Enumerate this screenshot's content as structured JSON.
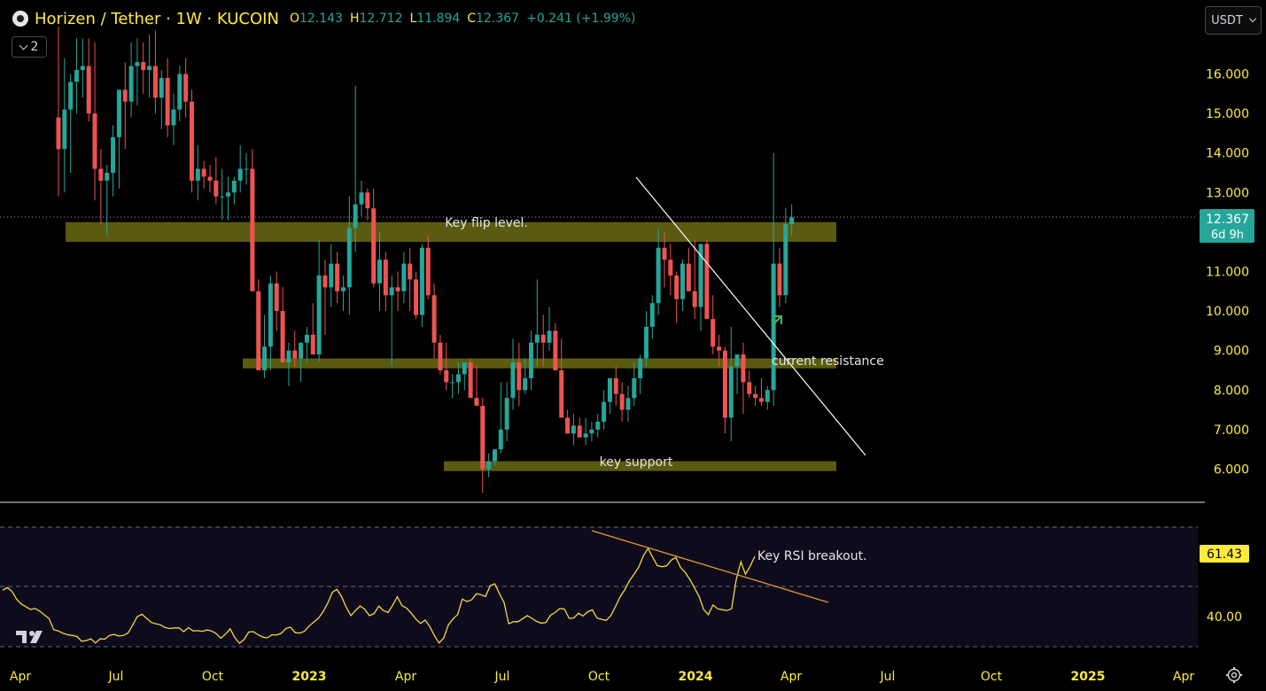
{
  "header": {
    "symbol_label": "Horizen / Tether · 1W · KUCOIN",
    "ohlc": [
      {
        "key": "O",
        "value": "12.143"
      },
      {
        "key": "H",
        "value": "12.712"
      },
      {
        "key": "L",
        "value": "11.894"
      },
      {
        "key": "C",
        "value": "12.367"
      }
    ],
    "change": "+0.241 (+1.99%)",
    "indicators_count": "2"
  },
  "currency_selector": {
    "value": "USDT"
  },
  "price_axis": {
    "ticks": [
      "16.000",
      "15.000",
      "14.000",
      "13.000",
      "11.000",
      "10.000",
      "9.000",
      "8.000",
      "7.000",
      "6.000"
    ],
    "last_price": "12.367",
    "countdown": "6d 9h"
  },
  "rsi_axis": {
    "ticks": [
      "40.00"
    ],
    "last_value": "61.43"
  },
  "time_axis": {
    "ticks": [
      "Apr",
      "Jul",
      "Oct",
      "2023",
      "Apr",
      "Jul",
      "Oct",
      "2024",
      "Apr",
      "Jul",
      "Oct",
      "2025",
      "Apr"
    ]
  },
  "annotations": {
    "flip_level": "Key flip level.",
    "current_resistance": "current resistance",
    "key_support": "key support",
    "rsi_breakout": "Key RSI breakout."
  },
  "colors": {
    "background": "#000000",
    "up": "#26a69a",
    "down": "#ef5350",
    "accent": "#ffeb3b",
    "zone": "#6b6a14",
    "rsi_line": "#f5d742",
    "trendline": "#ffffff",
    "rsi_trendline": "#e89a2c",
    "arrow": "#4caf50"
  },
  "icons": {
    "logo": "horizen-coin-icon",
    "collapse": "chevron-down-icon",
    "currency": "chevron-down-icon",
    "tradingview": "tradingview-logo",
    "settings": "gear-icon"
  },
  "chart_data": [
    {
      "type": "candlestick",
      "title": "Horizen / Tether · 1W · KUCOIN",
      "ylim": [
        5.3,
        17.0
      ],
      "zones": [
        {
          "label": "Key flip level.",
          "range": [
            11.75,
            12.25
          ]
        },
        {
          "label": "current resistance",
          "range": [
            8.55,
            8.8
          ]
        },
        {
          "label": "key support",
          "range": [
            5.95,
            6.2
          ]
        }
      ],
      "candles": [
        [
          14.9,
          17.2,
          12.9,
          14.1
        ],
        [
          14.1,
          16.4,
          13.0,
          15.1
        ],
        [
          15.1,
          16.0,
          13.5,
          15.8
        ],
        [
          15.8,
          16.9,
          15.0,
          16.1
        ],
        [
          16.1,
          16.9,
          15.4,
          16.2
        ],
        [
          16.2,
          16.9,
          14.8,
          15.0
        ],
        [
          15.0,
          16.8,
          12.8,
          13.6
        ],
        [
          13.6,
          14.1,
          12.2,
          13.3
        ],
        [
          13.3,
          13.7,
          11.9,
          13.5
        ],
        [
          13.5,
          14.7,
          12.9,
          14.4
        ],
        [
          14.4,
          15.6,
          13.1,
          15.6
        ],
        [
          15.6,
          16.3,
          14.1,
          15.3
        ],
        [
          15.3,
          16.8,
          14.9,
          16.2
        ],
        [
          16.2,
          16.9,
          15.2,
          16.3
        ],
        [
          16.3,
          16.8,
          15.5,
          16.1
        ],
        [
          16.1,
          17.0,
          15.4,
          16.2
        ],
        [
          16.2,
          17.1,
          15.0,
          15.4
        ],
        [
          15.4,
          16.1,
          14.6,
          15.9
        ],
        [
          15.9,
          16.4,
          14.4,
          14.7
        ],
        [
          14.7,
          15.5,
          14.2,
          15.1
        ],
        [
          15.1,
          16.2,
          14.8,
          16.0
        ],
        [
          16.0,
          16.4,
          14.9,
          15.3
        ],
        [
          15.3,
          15.6,
          13.0,
          13.3
        ],
        [
          13.3,
          14.2,
          12.8,
          13.6
        ],
        [
          13.6,
          13.8,
          13.1,
          13.4
        ],
        [
          13.4,
          13.7,
          13.0,
          13.3
        ],
        [
          13.3,
          13.9,
          12.7,
          12.9
        ],
        [
          12.9,
          13.6,
          12.3,
          12.9
        ],
        [
          12.9,
          13.4,
          12.3,
          13.0
        ],
        [
          13.0,
          13.4,
          12.7,
          13.3
        ],
        [
          13.3,
          14.2,
          13.0,
          13.6
        ],
        [
          13.6,
          14.0,
          13.2,
          13.6
        ],
        [
          13.6,
          14.1,
          11.0,
          10.5
        ],
        [
          10.5,
          10.8,
          9.7,
          8.5
        ],
        [
          8.5,
          9.9,
          8.3,
          9.1
        ],
        [
          9.1,
          10.9,
          8.5,
          10.7
        ],
        [
          10.7,
          11.0,
          9.5,
          10.0
        ],
        [
          10.0,
          10.6,
          8.9,
          8.7
        ],
        [
          8.7,
          9.2,
          8.1,
          9.0
        ],
        [
          9.0,
          9.5,
          8.6,
          8.8
        ],
        [
          8.8,
          9.2,
          8.2,
          9.2
        ],
        [
          9.2,
          9.6,
          8.7,
          9.4
        ],
        [
          9.4,
          10.2,
          8.9,
          8.9
        ],
        [
          8.9,
          11.8,
          8.7,
          10.9
        ],
        [
          10.9,
          11.3,
          9.4,
          10.6
        ],
        [
          10.6,
          11.7,
          10.1,
          11.2
        ],
        [
          11.2,
          11.5,
          10.2,
          10.5
        ],
        [
          10.5,
          10.9,
          10.0,
          10.6
        ],
        [
          10.6,
          12.9,
          9.9,
          12.1
        ],
        [
          12.1,
          15.7,
          11.5,
          12.7
        ],
        [
          12.7,
          13.3,
          12.4,
          13.0
        ],
        [
          13.0,
          13.1,
          12.3,
          12.6
        ],
        [
          12.6,
          13.1,
          10.6,
          10.7
        ],
        [
          10.7,
          12.0,
          10.0,
          11.3
        ],
        [
          11.3,
          11.5,
          10.0,
          10.4
        ],
        [
          10.4,
          10.9,
          8.6,
          10.6
        ],
        [
          10.6,
          11.0,
          10.0,
          10.5
        ],
        [
          10.5,
          11.5,
          10.2,
          11.2
        ],
        [
          11.2,
          11.6,
          10.0,
          10.8
        ],
        [
          10.8,
          11.0,
          9.8,
          9.9
        ],
        [
          9.9,
          11.7,
          9.6,
          11.6
        ],
        [
          11.6,
          11.9,
          10.3,
          10.4
        ],
        [
          10.4,
          10.7,
          8.8,
          9.2
        ],
        [
          9.2,
          9.4,
          8.4,
          8.5
        ],
        [
          8.5,
          9.2,
          8.0,
          8.2
        ],
        [
          8.2,
          8.4,
          7.8,
          8.2
        ],
        [
          8.2,
          8.7,
          7.9,
          8.4
        ],
        [
          8.4,
          8.7,
          8.0,
          8.7
        ],
        [
          8.7,
          8.8,
          7.8,
          7.8
        ],
        [
          7.8,
          8.6,
          7.7,
          7.6
        ],
        [
          7.6,
          7.8,
          5.4,
          6.0
        ],
        [
          6.0,
          6.4,
          5.8,
          6.2
        ],
        [
          6.2,
          6.5,
          6.1,
          6.5
        ],
        [
          6.5,
          8.2,
          6.4,
          7.0
        ],
        [
          7.0,
          8.2,
          6.7,
          7.8
        ],
        [
          7.8,
          9.3,
          7.5,
          8.7
        ],
        [
          8.7,
          9.2,
          7.6,
          8.0
        ],
        [
          8.0,
          8.8,
          7.9,
          8.3
        ],
        [
          8.3,
          9.5,
          8.0,
          9.2
        ],
        [
          9.2,
          10.8,
          8.6,
          9.4
        ],
        [
          9.4,
          9.9,
          8.6,
          9.2
        ],
        [
          9.2,
          10.1,
          9.0,
          9.5
        ],
        [
          9.5,
          9.7,
          8.5,
          8.5
        ],
        [
          8.5,
          9.3,
          7.6,
          7.3
        ],
        [
          7.3,
          7.5,
          6.9,
          6.9
        ],
        [
          6.9,
          7.4,
          6.6,
          7.1
        ],
        [
          7.1,
          7.3,
          6.8,
          6.8
        ],
        [
          6.8,
          7.3,
          6.6,
          6.9
        ],
        [
          6.9,
          7.2,
          6.7,
          7.0
        ],
        [
          7.0,
          7.4,
          6.8,
          7.2
        ],
        [
          7.2,
          8.0,
          7.0,
          7.7
        ],
        [
          7.7,
          8.3,
          7.4,
          8.3
        ],
        [
          8.3,
          8.6,
          7.6,
          7.9
        ],
        [
          7.9,
          8.2,
          7.2,
          7.5
        ],
        [
          7.5,
          8.1,
          7.2,
          7.8
        ],
        [
          7.8,
          8.7,
          7.6,
          8.3
        ],
        [
          8.3,
          8.9,
          7.9,
          8.8
        ],
        [
          8.8,
          10.0,
          8.6,
          9.6
        ],
        [
          9.6,
          10.4,
          9.3,
          10.2
        ],
        [
          10.2,
          12.1,
          9.9,
          11.6
        ],
        [
          11.6,
          12.0,
          10.6,
          11.3
        ],
        [
          11.3,
          11.7,
          10.4,
          10.9
        ],
        [
          10.9,
          11.0,
          9.7,
          10.3
        ],
        [
          10.3,
          11.3,
          10.0,
          11.2
        ],
        [
          11.2,
          11.6,
          10.5,
          10.5
        ],
        [
          10.5,
          11.8,
          9.8,
          10.1
        ],
        [
          10.1,
          11.7,
          9.5,
          11.7
        ],
        [
          11.7,
          11.8,
          9.9,
          9.8
        ],
        [
          9.8,
          10.4,
          8.9,
          9.1
        ],
        [
          9.1,
          9.4,
          8.6,
          9.0
        ],
        [
          9.0,
          9.1,
          6.9,
          7.3
        ],
        [
          7.3,
          9.6,
          6.7,
          8.6
        ],
        [
          8.6,
          8.9,
          7.9,
          8.9
        ],
        [
          8.9,
          9.2,
          7.4,
          8.2
        ],
        [
          8.2,
          8.5,
          7.8,
          7.9
        ],
        [
          7.9,
          8.1,
          7.6,
          7.8
        ],
        [
          7.8,
          8.3,
          7.6,
          7.7
        ],
        [
          7.7,
          8.1,
          7.5,
          8.0
        ],
        [
          8.0,
          14.0,
          7.6,
          11.2
        ],
        [
          11.2,
          11.6,
          10.1,
          10.4
        ],
        [
          10.4,
          12.6,
          10.2,
          12.2
        ],
        [
          12.2,
          12.7,
          11.9,
          12.37
        ]
      ]
    },
    {
      "type": "line",
      "title": "RSI",
      "ylim": [
        35,
        70
      ],
      "values": [
        51.5,
        52.3,
        51.2,
        48.9,
        47.5,
        46.7,
        45.9,
        46.2,
        45.4,
        44.3,
        43.2,
        40.0,
        39.6,
        38.9,
        38.5,
        38.3,
        38.0,
        36.6,
        36.8,
        37.3,
        36.1,
        37.3,
        37.2,
        38.3,
        38.6,
        38.1,
        38.3,
        39.0,
        41.3,
        43.8,
        44.5,
        43.3,
        42.1,
        41.7,
        41.4,
        40.6,
        40.3,
        40.5,
        40.5,
        39.4,
        40.6,
        39.6,
        39.7,
        39.5,
        39.9,
        39.6,
        38.8,
        37.5,
        38.7,
        40.2,
        37.7,
        36.0,
        37.1,
        39.3,
        39.4,
        38.5,
        37.8,
        37.6,
        38.5,
        38.4,
        38.9,
        40.3,
        40.7,
        39.1,
        39.0,
        39.5,
        41.0,
        42.2,
        43.3,
        45.2,
        47.7,
        50.9,
        51.8,
        49.6,
        46.5,
        44.1,
        45.6,
        46.9,
        45.9,
        44.1,
        44.7,
        46.9,
        45.6,
        45.0,
        47.1,
        49.6,
        47.0,
        46.3,
        44.8,
        43.1,
        41.8,
        42.8,
        40.9,
        38.2,
        36.1,
        37.6,
        41.4,
        43.1,
        44.4,
        48.9,
        48.2,
        48.7,
        50.5,
        50.2,
        49.7,
        52.8,
        53.4,
        50.5,
        47.9,
        41.7,
        42.3,
        42.3,
        43.2,
        44.1,
        43.3,
        42.4,
        41.9,
        42.1,
        44.2,
        45.0,
        46.2,
        46.0,
        43.3,
        43.4,
        44.8,
        44.0,
        45.2,
        45.8,
        43.4,
        43.0,
        42.7,
        44.1,
        46.8,
        49.6,
        51.7,
        54.3,
        56.2,
        58.3,
        61.6,
        63.7,
        61.2,
        58.7,
        58.4,
        58.6,
        60.3,
        61.1,
        58.2,
        56.7,
        54.7,
        52.2,
        49.7,
        45.8,
        44.4,
        47.2,
        46.1,
        45.8,
        45.6,
        46.1,
        54.6,
        59.8,
        56.2,
        58.6,
        61.43
      ]
    }
  ]
}
